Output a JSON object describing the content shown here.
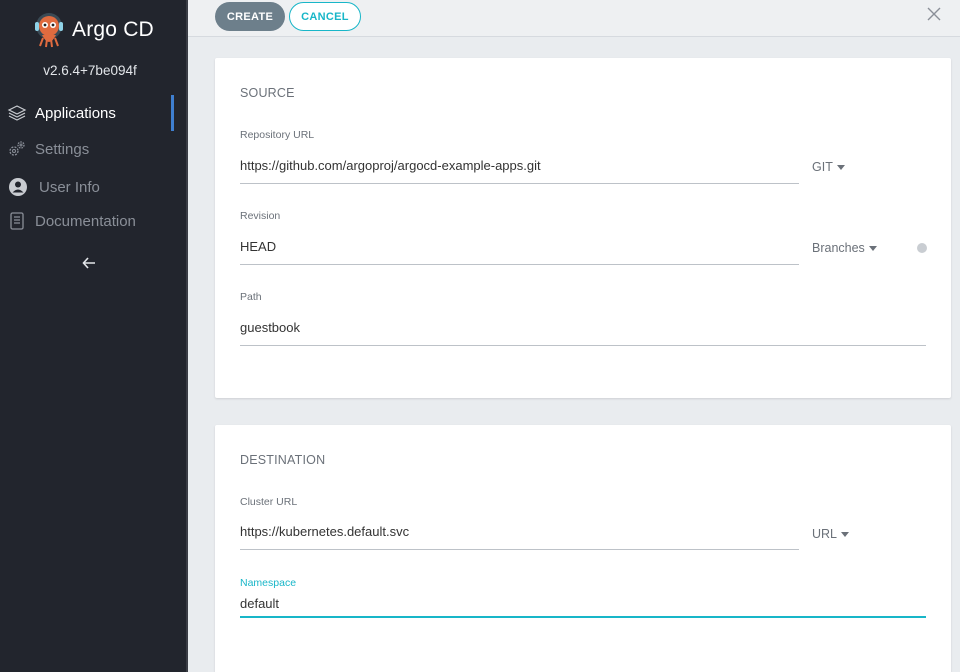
{
  "app": {
    "name": "Argo CD",
    "version": "v2.6.4+7be094f"
  },
  "sidebar": {
    "items": [
      {
        "label": "Applications",
        "icon": "layers-icon",
        "active": true
      },
      {
        "label": "Settings",
        "icon": "gears-icon",
        "active": false
      },
      {
        "label": "User Info",
        "icon": "user-circle-icon",
        "active": false
      },
      {
        "label": "Documentation",
        "icon": "book-icon",
        "active": false
      }
    ],
    "collapse_icon": "arrow-left-icon"
  },
  "toolbar": {
    "create_label": "CREATE",
    "cancel_label": "CANCEL",
    "close_icon": "close-icon"
  },
  "source": {
    "title": "SOURCE",
    "repo_label": "Repository URL",
    "repo_value": "https://github.com/argoproj/argocd-example-apps.git",
    "repo_type": "GIT",
    "revision_label": "Revision",
    "revision_value": "HEAD",
    "revision_type": "Branches",
    "path_label": "Path",
    "path_value": "guestbook"
  },
  "destination": {
    "title": "DESTINATION",
    "cluster_label": "Cluster URL",
    "cluster_value": "https://kubernetes.default.svc",
    "cluster_type": "URL",
    "namespace_label": "Namespace",
    "namespace_value": "default"
  },
  "colors": {
    "sidebar_bg": "#22252d",
    "accent": "#18b6c8",
    "active_bar": "#3f7fd0",
    "create_btn": "#6d7f8b"
  }
}
